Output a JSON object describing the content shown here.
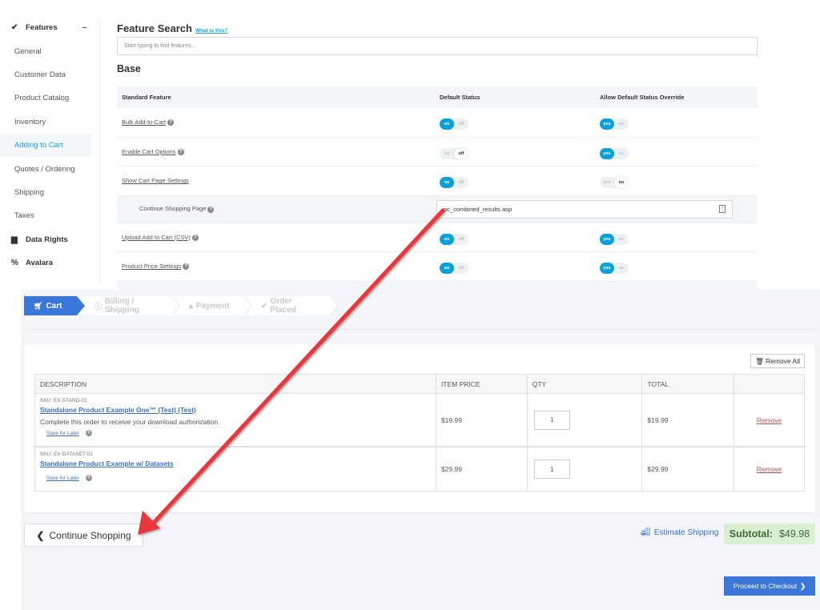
{
  "admin": {
    "sidebar": {
      "group_features": {
        "label": "Features",
        "icon": "double-check-icon",
        "collapse_label": "–"
      },
      "items": [
        {
          "label": "General",
          "active": false
        },
        {
          "label": "Customer Data",
          "active": false
        },
        {
          "label": "Product Catalog",
          "active": false
        },
        {
          "label": "Inventory",
          "active": false
        },
        {
          "label": "Adding to Cart",
          "active": true
        },
        {
          "label": "Quotes / Ordering",
          "active": false
        },
        {
          "label": "Shipping",
          "active": false
        },
        {
          "label": "Taxes",
          "active": false
        }
      ],
      "group_data_rights": {
        "label": "Data Rights",
        "icon": "car-icon"
      },
      "group_avalara": {
        "label": "Avalara",
        "icon": "percent-icon"
      }
    },
    "feature_search": {
      "title": "Feature Search",
      "help_link": "What is this?",
      "placeholder": "Start typing to find features..."
    },
    "section_title": "Base",
    "table": {
      "headers": [
        "Standard Feature",
        "Default Status",
        "Allow Default Status Override"
      ],
      "rows": [
        {
          "feature": "Bulk Add-to-Cart",
          "help": true,
          "status": {
            "on": "on",
            "off": "off",
            "value": "on"
          },
          "override": {
            "yes": "yes",
            "no": "no",
            "value": "yes"
          }
        },
        {
          "feature": "Enable Cart Options",
          "help": true,
          "status": {
            "on": "on",
            "off": "off",
            "value": "off"
          },
          "override": {
            "yes": "yes",
            "no": "no",
            "value": "yes"
          }
        },
        {
          "feature": "Show Cart Page Settings",
          "help": false,
          "status": {
            "on": "on",
            "off": "off",
            "value": "on"
          },
          "override": {
            "yes": "yes",
            "no": "no",
            "value": "no"
          }
        },
        {
          "feature": "Continue Shopping Page",
          "help": true,
          "sub": true,
          "input_value": "pc_combined_results.asp"
        },
        {
          "feature": "Upload Add to Cart (CSV)",
          "help": true,
          "status": {
            "on": "on",
            "off": "off",
            "value": "on"
          },
          "override": {
            "yes": "yes",
            "no": "no",
            "value": "yes"
          }
        },
        {
          "feature": "Product Price Settings",
          "help": true,
          "status": {
            "on": "on",
            "off": "off",
            "value": "on"
          },
          "override": {
            "yes": "yes",
            "no": "no",
            "value": "yes"
          }
        }
      ]
    }
  },
  "cart": {
    "steps": [
      {
        "label": "Cart",
        "icon": "shopping-cart-icon",
        "active": true
      },
      {
        "label": "Billing / Shipping",
        "icon": "info-circle-icon",
        "active": false
      },
      {
        "label": "Payment",
        "icon": "lock-icon",
        "active": false
      },
      {
        "label": "Order Placed",
        "icon": "check-icon",
        "active": false
      }
    ],
    "remove_all_label": "Remove All",
    "table": {
      "headers": [
        "DESCRIPTION",
        "ITEM PRICE",
        "QTY",
        "TOTAL",
        ""
      ],
      "items": [
        {
          "sku": "SKU: EX-STAND-01",
          "name": "Standalone Product Example One™ (Test) (Test)",
          "description": "Complete this order to receive your download authorization.",
          "save_label": "Save for Later",
          "price": "$19.99",
          "qty": "1",
          "total": "$19.99",
          "remove_label": "Remove"
        },
        {
          "sku": "SKU: EX-DATASET-01",
          "name": "Standalone Product Example w/ Datasets",
          "description": "",
          "save_label": "Save for Later",
          "price": "$29.99",
          "qty": "1",
          "total": "$29.99",
          "remove_label": "Remove"
        }
      ]
    },
    "continue_shopping_label": "Continue Shopping",
    "estimate_shipping_label": "Estimate Shipping",
    "subtotal_label": "Subtotal:",
    "subtotal_value": "$49.98",
    "checkout_label": "Proceed to Checkout"
  },
  "annotation": {
    "color": "#e8383d",
    "description": "arrow from Continue Shopping Page setting to Continue Shopping button"
  }
}
